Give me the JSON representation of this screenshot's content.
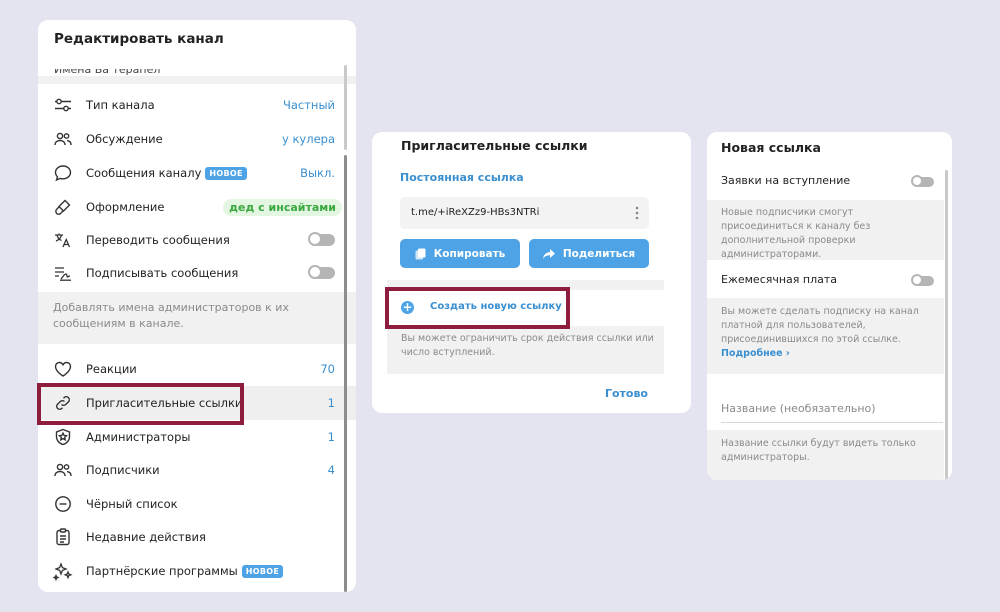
{
  "edit_channel": {
    "title": "Редактировать канал",
    "cut_text": "Имена Ба терапел",
    "settings": [
      {
        "label": "Тип канала",
        "value": "Частный",
        "icon": "sliders-icon"
      },
      {
        "label": "Обсуждение",
        "value": "у кулера",
        "icon": "people-icon"
      },
      {
        "label": "Сообщения каналу",
        "badge": "НОВОЕ",
        "value": "Выкл.",
        "icon": "chat-bubble-icon"
      },
      {
        "label": "Оформление",
        "value": "дед с инсайтами",
        "icon": "brush-icon"
      },
      {
        "label": "Переводить сообщения",
        "icon": "translate-icon"
      },
      {
        "label": "Подписывать сообщения",
        "icon": "signature-icon"
      }
    ],
    "sign_hint": "Добавлять имена администраторов к их сообщениям в канале.",
    "management": [
      {
        "label": "Реакции",
        "value": "70",
        "icon": "heart-icon"
      },
      {
        "label": "Пригласительные ссылки",
        "value": "1",
        "icon": "link-icon"
      },
      {
        "label": "Администраторы",
        "value": "1",
        "icon": "admin-shield-icon"
      },
      {
        "label": "Подписчики",
        "value": "4",
        "icon": "people-icon"
      },
      {
        "label": "Чёрный список",
        "icon": "block-icon"
      },
      {
        "label": "Недавние действия",
        "icon": "clipboard-icon"
      },
      {
        "label": "Партнёрские программы",
        "badge": "НОВОЕ",
        "icon": "sparkles-icon"
      }
    ]
  },
  "invite_links": {
    "title": "Пригласительные ссылки",
    "permanent_label": "Постоянная ссылка",
    "link": "t.me/+iReXZz9-HBs3NTRi",
    "copy_label": "Копировать",
    "share_label": "Поделиться",
    "create_label": "Создать новую ссылку",
    "hint": "Вы можете ограничить срок действия ссылки или число вступлений.",
    "done_label": "Готово"
  },
  "new_link": {
    "title": "Новая ссылка",
    "requests_label": "Заявки на вступление",
    "requests_hint": "Новые подписчики смогут присоединиться к каналу без дополнительной проверки администраторами.",
    "monthly_label": "Ежемесячная плата",
    "monthly_hint": "Вы можете сделать подписку на канал платной для пользователей, присоединившихся по этой ссылке.",
    "more_link": "Подробнее ›",
    "name_placeholder": "Название (необязательно)",
    "name_hint": "Название ссылки будут видеть только администраторы."
  },
  "colors": {
    "accent": "#4da3e6",
    "highlight": "#8e1c3d",
    "green_pill": "#3aa83e"
  }
}
